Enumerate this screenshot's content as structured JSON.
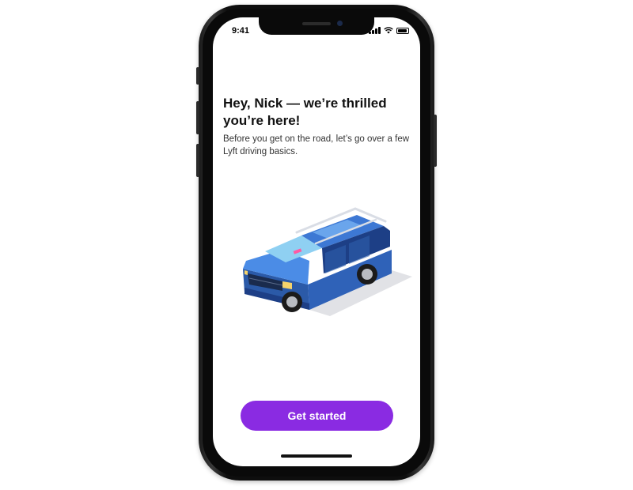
{
  "status_bar": {
    "time": "9:41",
    "icons": [
      "signal-icon",
      "wifi-icon",
      "battery-icon"
    ]
  },
  "content": {
    "headline": "Hey, Nick — we’re thrilled you’re here!",
    "subtext": "Before you get on the road, let’s go over a few Lyft driving basics.",
    "illustration": "blue-suv-illustration"
  },
  "actions": {
    "primary_label": "Get started"
  },
  "colors": {
    "accent": "#8a2be2",
    "car_body": "#3f7fd9",
    "text_primary": "#111111"
  }
}
